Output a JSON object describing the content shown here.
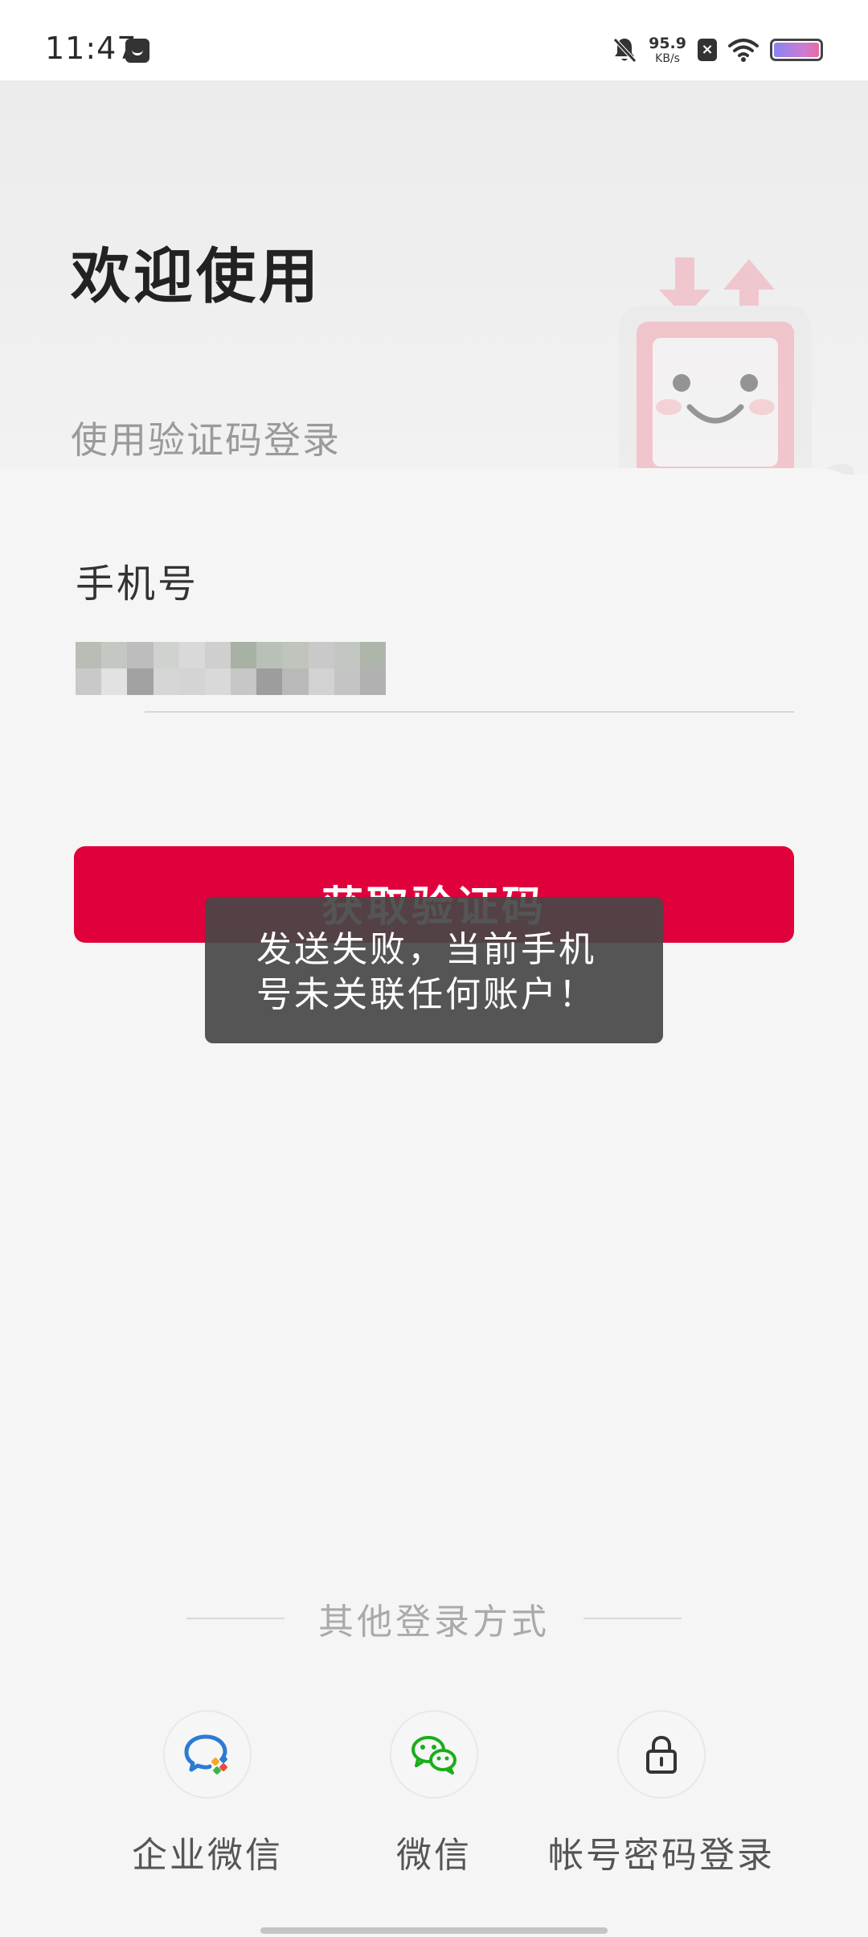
{
  "status_bar": {
    "time": "11:47",
    "net_speed_value": "95.9",
    "net_speed_unit": "KB/s",
    "icons": [
      "app-notification-icon",
      "mute-bell-icon",
      "sim-off-icon",
      "wifi-icon",
      "battery-icon"
    ]
  },
  "header": {
    "title": "欢迎使用",
    "subtitle": "使用验证码登录"
  },
  "form": {
    "phone_label": "手机号",
    "send_code_button": "获取验证码"
  },
  "toast": {
    "message": "发送失败，当前手机号未关联任何账户！"
  },
  "other_login": {
    "title": "其他登录方式",
    "options": [
      {
        "label": "企业微信",
        "icon": "wecom-icon"
      },
      {
        "label": "微信",
        "icon": "wechat-icon"
      },
      {
        "label": "帐号密码登录",
        "icon": "lock-icon"
      }
    ]
  },
  "colors": {
    "primary": "#e0003b",
    "toast_bg": "#464646",
    "background": "#f5f5f5"
  }
}
